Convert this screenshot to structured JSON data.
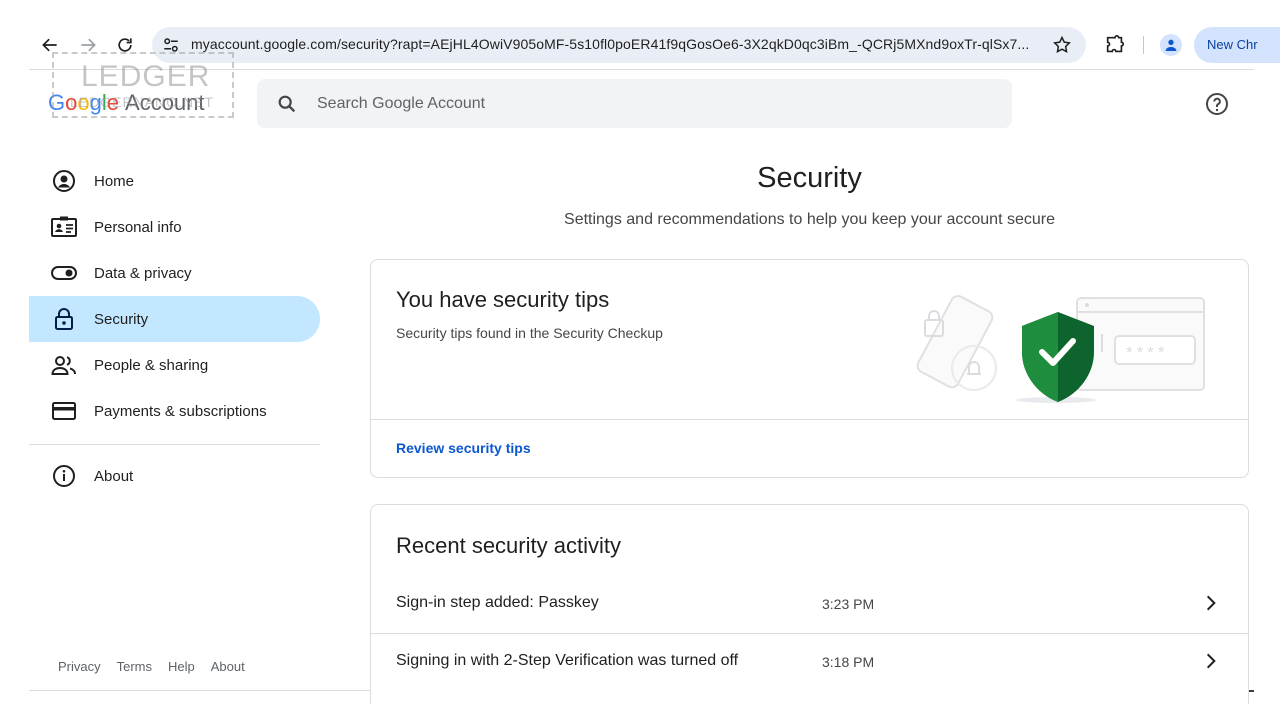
{
  "browser": {
    "url": "myaccount.google.com/security?rapt=AEjHL4OwiV905oMF-5s10fl0poER41f9qGosOe6-3X2qkD0qc3iBm_-QCRj5MXnd9oxTr-qlSx7...",
    "new_chrome_label": "New Chr"
  },
  "header": {
    "logo": {
      "g1": "G",
      "g2": "o",
      "g3": "o",
      "g4": "g",
      "g5": "l",
      "g6": "e",
      "account": "Account"
    },
    "watermark": {
      "line1": "LEDGER",
      "line2": "LEDGERNANO.NET"
    },
    "search_placeholder": "Search Google Account"
  },
  "sidebar": {
    "items": [
      {
        "label": "Home",
        "icon": "account-circle-icon"
      },
      {
        "label": "Personal info",
        "icon": "id-card-icon"
      },
      {
        "label": "Data & privacy",
        "icon": "toggle-icon"
      },
      {
        "label": "Security",
        "icon": "lock-icon",
        "active": true
      },
      {
        "label": "People & sharing",
        "icon": "people-icon"
      },
      {
        "label": "Payments & subscriptions",
        "icon": "credit-card-icon"
      }
    ],
    "about": {
      "label": "About",
      "icon": "info-icon"
    }
  },
  "footer": {
    "links": [
      "Privacy",
      "Terms",
      "Help",
      "About"
    ]
  },
  "main": {
    "title": "Security",
    "subtitle": "Settings and recommendations to help you keep your account secure",
    "tips_card": {
      "title": "You have security tips",
      "subtitle": "Security tips found in the Security Checkup",
      "link": "Review security tips",
      "illustration_password_mask": "****"
    },
    "activity_card": {
      "title": "Recent security activity",
      "rows": [
        {
          "text": "Sign-in step added: Passkey",
          "time": "3:23 PM"
        },
        {
          "text": "Signing in with 2-Step Verification was turned off",
          "time": "3:18 PM"
        }
      ]
    }
  },
  "colors": {
    "accent_blue": "#0b57d0",
    "active_nav_bg": "#c2e7ff",
    "shield_green": "#1e8e3e"
  }
}
